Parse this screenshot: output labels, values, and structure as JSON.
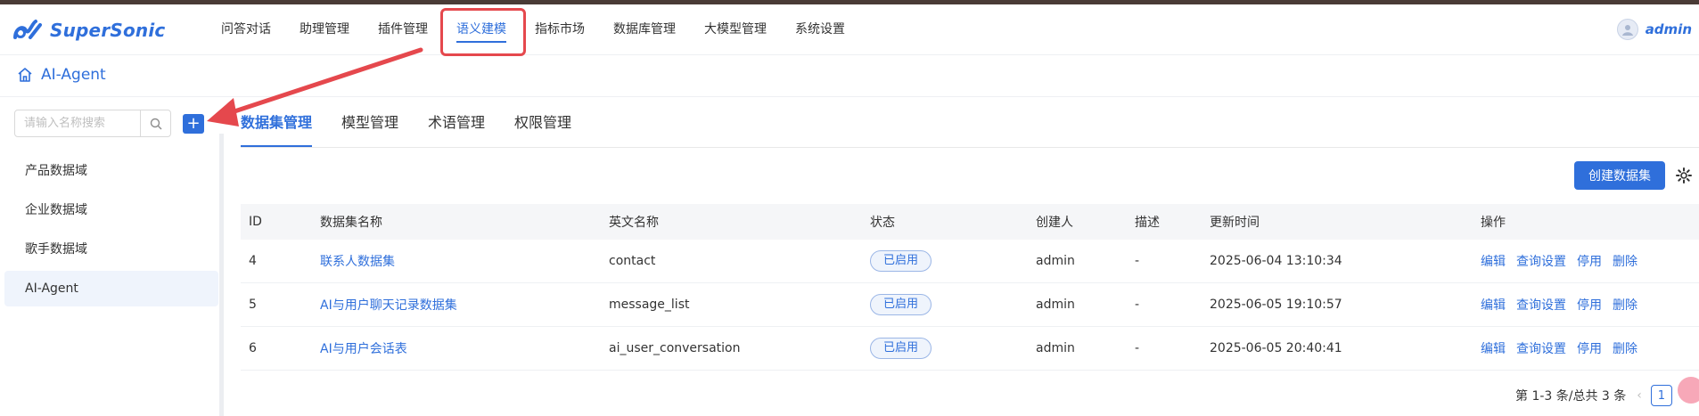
{
  "app": {
    "name": "SuperSonic"
  },
  "nav": {
    "items": [
      {
        "label": "问答对话"
      },
      {
        "label": "助理管理"
      },
      {
        "label": "插件管理"
      },
      {
        "label": "语义建模"
      },
      {
        "label": "指标市场"
      },
      {
        "label": "数据库管理"
      },
      {
        "label": "大模型管理"
      },
      {
        "label": "系统设置"
      }
    ],
    "active_index": 3
  },
  "user": {
    "name": "admin",
    "icon": "avatar-icon"
  },
  "breadcrumb": {
    "label": "AI-Agent",
    "icon": "home-icon"
  },
  "sidebar": {
    "search_placeholder": "请输入名称搜索",
    "add_label": "+",
    "items": [
      {
        "label": "产品数据域"
      },
      {
        "label": "企业数据域"
      },
      {
        "label": "歌手数据域"
      },
      {
        "label": "AI-Agent"
      }
    ],
    "selected_index": 3
  },
  "tabs": [
    {
      "label": "数据集管理"
    },
    {
      "label": "模型管理"
    },
    {
      "label": "术语管理"
    },
    {
      "label": "权限管理"
    }
  ],
  "toolbar": {
    "create_label": "创建数据集",
    "settings_icon": "gear-icon"
  },
  "table": {
    "headers": {
      "id": "ID",
      "name": "数据集名称",
      "en": "英文名称",
      "status": "状态",
      "creator": "创建人",
      "desc": "描述",
      "time": "更新时间",
      "op": "操作"
    },
    "rows": [
      {
        "id": "4",
        "name": "联系人数据集",
        "en": "contact",
        "status": "已启用",
        "creator": "admin",
        "desc": "-",
        "time": "2025-06-04 13:10:34"
      },
      {
        "id": "5",
        "name": "AI与用户聊天记录数据集",
        "en": "message_list",
        "status": "已启用",
        "creator": "admin",
        "desc": "-",
        "time": "2025-06-05 19:10:57"
      },
      {
        "id": "6",
        "name": "AI与用户会话表",
        "en": "ai_user_conversation",
        "status": "已启用",
        "creator": "admin",
        "desc": "-",
        "time": "2025-06-05 20:40:41"
      }
    ],
    "actions": {
      "edit": "编辑",
      "query": "查询设置",
      "disable": "停用",
      "delete": "删除"
    }
  },
  "pagination": {
    "summary": "第 1-3 条/总共 3 条",
    "current_page": "1",
    "prev": "‹"
  },
  "colors": {
    "primary": "#2f6fdb",
    "annotation": "#e5484d"
  }
}
